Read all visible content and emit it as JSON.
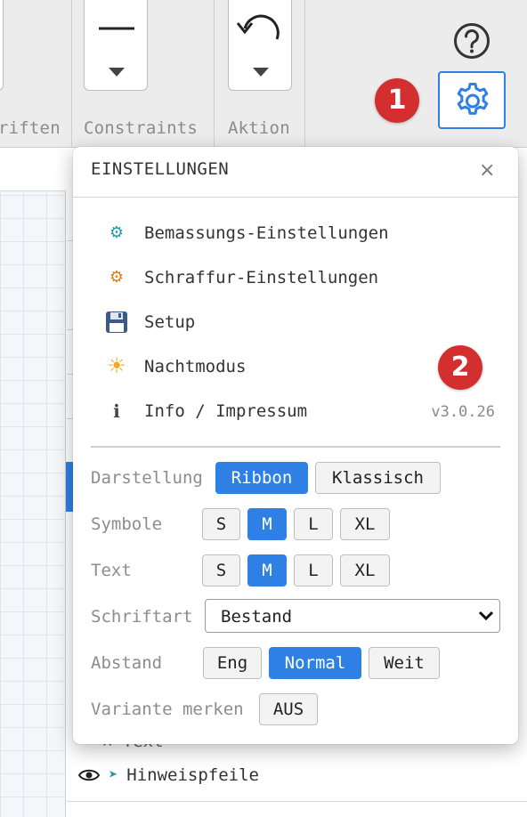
{
  "ribbon": {
    "groups": [
      {
        "label": "riften"
      },
      {
        "label": "Constraints"
      },
      {
        "label": "Aktion"
      }
    ],
    "badge_1": "1",
    "badge_2": "2",
    "icons": {
      "constraint": "horizontal-line-icon",
      "action": "undo-icon",
      "help": "help-circle-icon",
      "settings": "gear-icon"
    }
  },
  "dialog": {
    "title": "EINSTELLUNGEN",
    "close": "×",
    "menu": [
      {
        "icon": "⚙",
        "icon_name": "gear-teal-icon",
        "color": "#1f9aa6",
        "label": "Bemassungs-Einstellungen"
      },
      {
        "icon": "⚙",
        "icon_name": "gear-orange-icon",
        "color": "#e07b1a",
        "label": "Schraffur-Einstellungen"
      },
      {
        "icon": "💾",
        "icon_name": "floppy-disk-icon",
        "color": "#3a5a8a",
        "label": "Setup"
      },
      {
        "icon": "☀",
        "icon_name": "sun-icon",
        "color": "#f2a91c",
        "label": "Nachtmodus"
      },
      {
        "icon": "ℹ",
        "icon_name": "info-icon",
        "color": "#444444",
        "label": "Info / Impressum",
        "version": "v3.0.26"
      }
    ],
    "options": {
      "darstellung": {
        "label": "Darstellung",
        "choices": [
          "Ribbon",
          "Klassisch"
        ],
        "selected": "Ribbon"
      },
      "symbole": {
        "label": "Symbole",
        "choices": [
          "S",
          "M",
          "L",
          "XL"
        ],
        "selected": "M"
      },
      "text": {
        "label": "Text",
        "choices": [
          "S",
          "M",
          "L",
          "XL"
        ],
        "selected": "M"
      },
      "schriftart": {
        "label": "Schriftart",
        "value": "Bestand"
      },
      "abstand": {
        "label": "Abstand",
        "choices": [
          "Eng",
          "Normal",
          "Weit"
        ],
        "selected": "Normal"
      },
      "variante": {
        "label": "Variante merken",
        "toggle": "AUS"
      }
    }
  },
  "layers": {
    "partial": "- ✕ Text",
    "row_label": "Hinweispfeile"
  },
  "colors": {
    "accent": "#2f80e4",
    "badge": "#d32f2f"
  }
}
